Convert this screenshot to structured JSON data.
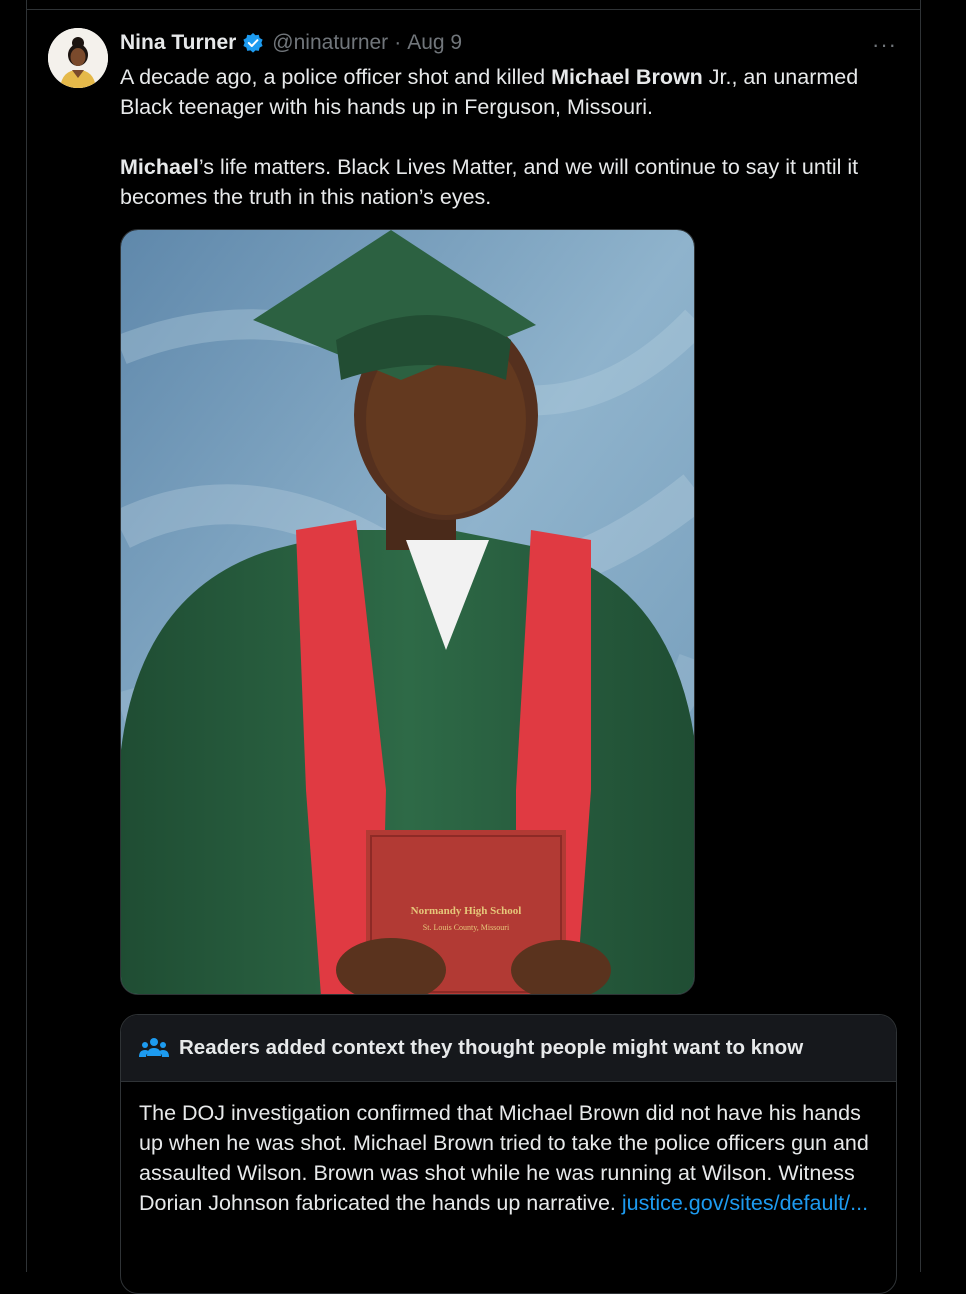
{
  "tweet": {
    "author_name": "Nina Turner",
    "handle": "@ninaturner",
    "separator": "·",
    "date": "Aug 9",
    "more_label": "···",
    "text_p1": {
      "part1": "A decade ago, a police officer shot and killed ",
      "bold1": "Michael Brown",
      "part2": " Jr., an unarmed Black teenager with his hands up in Ferguson, Missouri."
    },
    "text_p2": {
      "bold1": "Michael",
      "part1": "’s life matters. Black Lives Matter, and we will continue to say it until it becomes the truth in this nation’s eyes."
    }
  },
  "media": {
    "diploma_line1": "Normandy High School",
    "diploma_line2": "St. Louis County, Missouri"
  },
  "community_note": {
    "heading": "Readers added context they thought people might want to know",
    "body": "The DOJ investigation confirmed that Michael Brown did not have his hands up when he was shot. Michael Brown tried to take the police officers gun and assaulted Wilson. Brown was shot while he was running at Wilson. Witness Dorian Johnson fabricated the hands up narrative. ",
    "link": "justice.gov/sites/default/..."
  },
  "colors": {
    "background": "#000000",
    "text": "#e7e9ea",
    "muted": "#71767b",
    "accent": "#1d9bf0",
    "border": "#2f3336"
  },
  "icons": [
    "verified-badge-icon",
    "more-options-icon",
    "community-notes-icon"
  ]
}
